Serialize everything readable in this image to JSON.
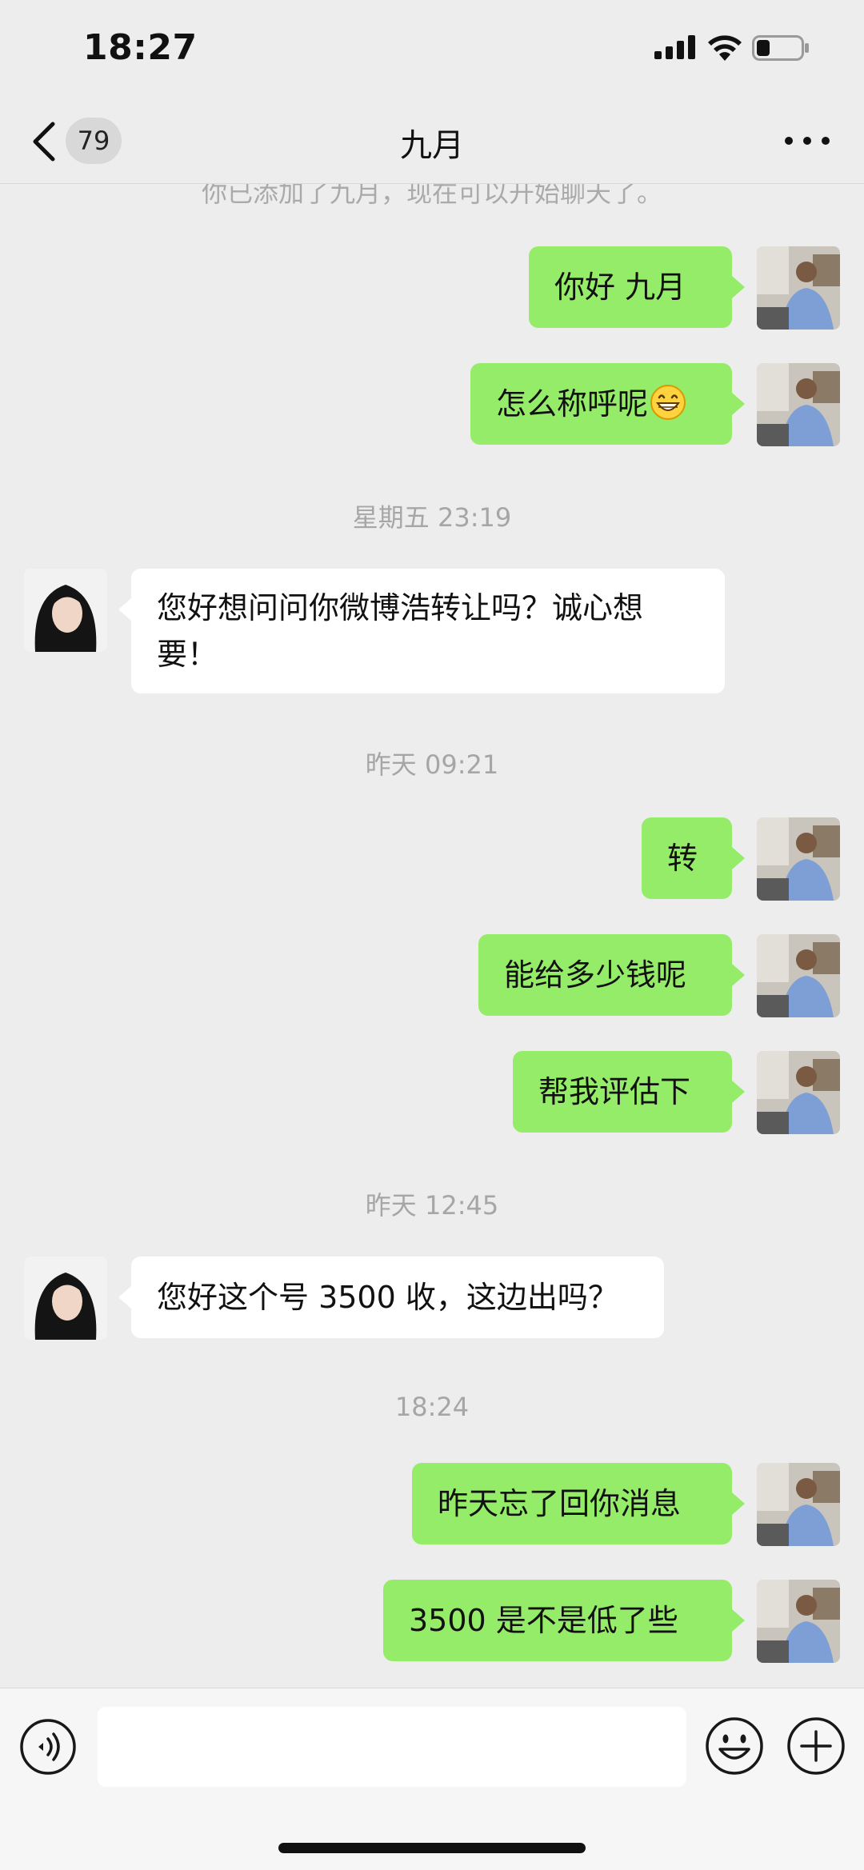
{
  "status_bar": {
    "time": "18:27"
  },
  "nav": {
    "badge_count": "79",
    "title": "九月"
  },
  "system_message": "你已添加了九月，现在可以开始聊天了。",
  "timestamps": [
    "星期五 23:19",
    "昨天 09:21",
    "昨天 12:45",
    "18:24"
  ],
  "messages": [
    {
      "sender": "me",
      "text": "你好 九月"
    },
    {
      "sender": "me",
      "text": "怎么称呼呢",
      "emoji": "grinning-face-emoji"
    },
    {
      "sender": "other",
      "text": "您好想问问你微博浩转让吗？诚心想要！"
    },
    {
      "sender": "me",
      "text": "转"
    },
    {
      "sender": "me",
      "text": "能给多少钱呢"
    },
    {
      "sender": "me",
      "text": "帮我评估下"
    },
    {
      "sender": "other",
      "text": "您好这个号 3500 收，这边出吗？"
    },
    {
      "sender": "me",
      "text": "昨天忘了回你消息"
    },
    {
      "sender": "me",
      "text": "3500 是不是低了些"
    }
  ],
  "input": {
    "value": "",
    "placeholder": ""
  },
  "colors": {
    "my_bubble": "#95ec69",
    "other_bubble": "#ffffff",
    "background": "#ededed"
  }
}
